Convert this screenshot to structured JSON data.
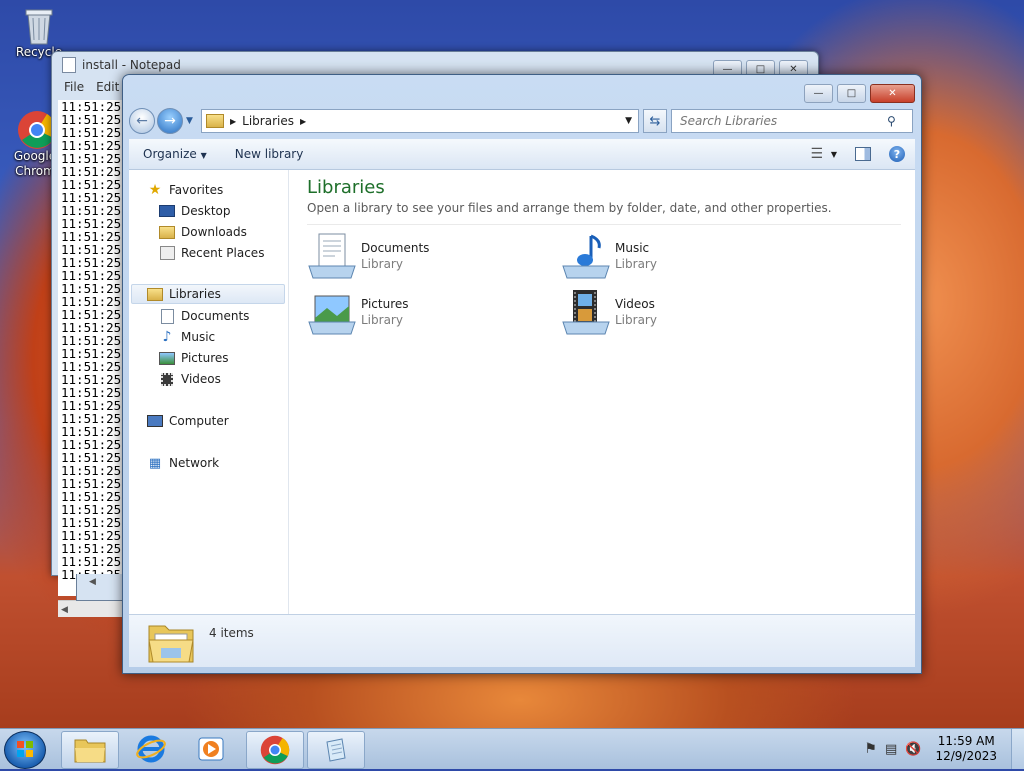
{
  "desktop": {
    "icons": [
      {
        "label": "Recycle"
      },
      {
        "label": "Google Chrom"
      }
    ]
  },
  "notepad": {
    "title": "install - Notepad",
    "menu": [
      "File",
      "Edit"
    ],
    "lines": [
      "11:51:25",
      "11:51:25",
      "11:51:25",
      "11:51:25",
      "11:51:25",
      "11:51:25",
      "11:51:25",
      "11:51:25",
      "11:51:25",
      "11:51:25",
      "11:51:25",
      "11:51:25",
      "11:51:25",
      "11:51:25",
      "11:51:25",
      "11:51:25",
      "11:51:25",
      "11:51:25",
      "11:51:25",
      "11:51:25",
      "11:51:25",
      "11:51:25",
      "11:51:25",
      "11:51:25",
      "11:51:25",
      "11:51:25",
      "11:51:25",
      "11:51:25",
      "11:51:25",
      "11:51:25",
      "11:51:25",
      "11:51:25",
      "11:51:25",
      "11:51:25",
      "11:51:25",
      "11:51:25",
      "11:51:25"
    ]
  },
  "explorer": {
    "address": {
      "crumb": "Libraries"
    },
    "search": {
      "placeholder": "Search Libraries"
    },
    "toolbar": {
      "organize": "Organize",
      "new_library": "New library"
    },
    "nav": {
      "favorites": "Favorites",
      "desktop": "Desktop",
      "downloads": "Downloads",
      "recent": "Recent Places",
      "libraries": "Libraries",
      "documents": "Documents",
      "music": "Music",
      "pictures": "Pictures",
      "videos": "Videos",
      "computer": "Computer",
      "network": "Network"
    },
    "main": {
      "title": "Libraries",
      "description": "Open a library to see your files and arrange them by folder, date, and other properties.",
      "items": [
        {
          "name": "Documents",
          "type": "Library"
        },
        {
          "name": "Music",
          "type": "Library"
        },
        {
          "name": "Pictures",
          "type": "Library"
        },
        {
          "name": "Videos",
          "type": "Library"
        }
      ]
    },
    "status": {
      "count": "4 items"
    }
  },
  "taskbar": {
    "time": "11:59 AM",
    "date": "12/9/2023"
  }
}
